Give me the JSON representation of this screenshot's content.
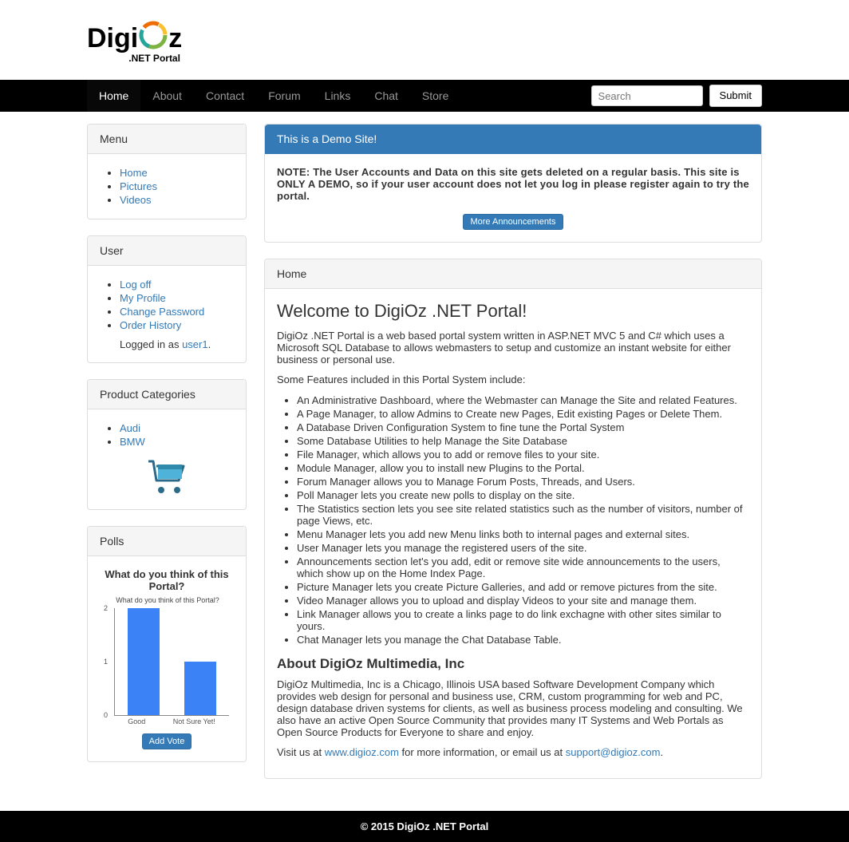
{
  "logo": {
    "part1": "Digi",
    "part2": "z",
    "sub": ".NET Portal"
  },
  "nav": {
    "items": [
      "Home",
      "About",
      "Contact",
      "Forum",
      "Links",
      "Chat",
      "Store"
    ],
    "active_index": 0,
    "search_placeholder": "Search",
    "submit": "Submit"
  },
  "sidebar": {
    "menu": {
      "title": "Menu",
      "items": [
        "Home",
        "Pictures",
        "Videos"
      ]
    },
    "user": {
      "title": "User",
      "items": [
        "Log off",
        "My Profile",
        "Change Password",
        "Order History"
      ],
      "logged_prefix": "Logged in as ",
      "username": "user1",
      "logged_suffix": "."
    },
    "categories": {
      "title": "Product Categories",
      "items": [
        "Audi",
        "BMW"
      ]
    },
    "polls": {
      "title": "Polls",
      "question": "What do you think of this Portal?",
      "add_vote": "Add Vote"
    }
  },
  "chart_data": {
    "type": "bar",
    "title": "What do you think of this Portal?",
    "categories": [
      "Good",
      "Not Sure Yet!"
    ],
    "values": [
      2,
      1
    ],
    "ylim": [
      0,
      2
    ],
    "ticks": [
      0,
      1,
      2
    ]
  },
  "announcement": {
    "title": "This is a Demo Site!",
    "body": "NOTE: The User Accounts and Data on this site gets deleted on a regular basis. This site is ONLY A DEMO, so if your user account does not let you log in please register again to try the portal.",
    "more": "More Announcements"
  },
  "home": {
    "panel_title": "Home",
    "welcome": "Welcome to DigiOz .NET Portal!",
    "intro": "DigiOz .NET Portal is a web based portal system written in ASP.NET MVC 5 and C# which uses a Microsoft SQL Database to allows webmasters to setup and customize an instant website for either business or personal use.",
    "features_lead": "Some Features included in this Portal System include:",
    "features": [
      "An Administrative Dashboard, where the Webmaster can Manage the Site and related Features.",
      "A Page Manager, to allow Admins to Create new Pages, Edit existing Pages or Delete Them.",
      "A Database Driven Configuration System to fine tune the Portal System",
      "Some Database Utilities to help Manage the Site Database",
      "File Manager, which allows you to add or remove files to your site.",
      "Module Manager, allow you to install new Plugins to the Portal.",
      "Forum Manager allows you to Manage Forum Posts, Threads, and Users.",
      "Poll Manager lets you create new polls to display on the site.",
      "The Statistics section lets you see site related statistics such as the number of visitors, number of page Views, etc.",
      "Menu Manager lets you add new Menu links both to internal pages and external sites.",
      "User Manager lets you manage the registered users of the site.",
      "Announcements section let's you add, edit or remove site wide announcements to the users, which show up on the Home Index Page.",
      "Picture Manager lets you create Picture Galleries, and add or remove pictures from the site.",
      "Video Manager allows you to upload and display Videos to your site and manage them.",
      "Link Manager allows you to create a links page to do link exchagne with other sites similar to yours.",
      "Chat Manager lets you manage the Chat Database Table."
    ],
    "about_title": "About DigiOz Multimedia, Inc",
    "about_body": "DigiOz Multimedia, Inc is a Chicago, Illinois USA based Software Development Company which provides web design for personal and business use, CRM, custom programming for web and PC, design database driven systems for clients, as well as business process modeling and consulting. We also have an active Open Source Community that provides many IT Systems and Web Portals as Open Source Products for Everyone to share and enjoy.",
    "visit_prefix": "Visit us at ",
    "visit_link": "www.digioz.com",
    "visit_mid": " for more information, or email us at ",
    "visit_email": "support@digioz.com",
    "visit_suffix": "."
  },
  "footer": "© 2015 DigiOz .NET Portal"
}
